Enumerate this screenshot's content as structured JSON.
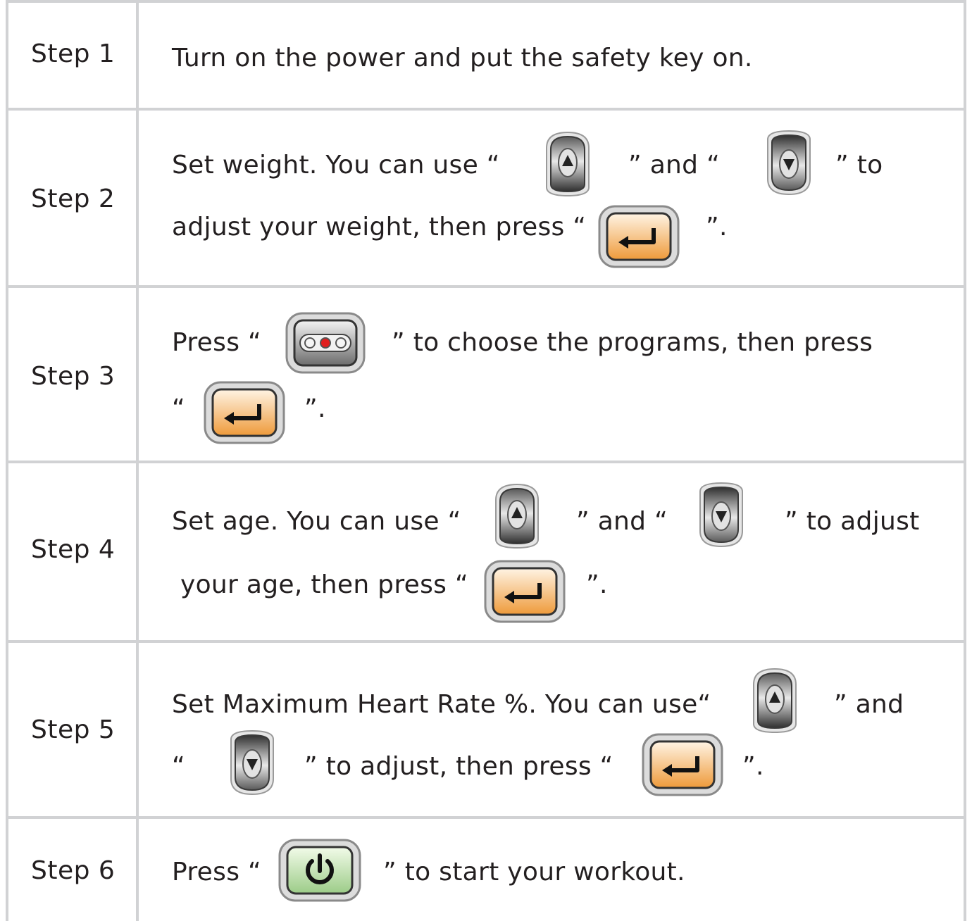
{
  "steps": [
    {
      "label": "Step 1",
      "parts": {
        "a": "Turn on the power and put the safety key on."
      }
    },
    {
      "label": "Step 2",
      "parts": {
        "a": "Set weight. You can use  “",
        "b": "” and “",
        "c": "” to",
        "d": "adjust your weight, then press “",
        "e": "”."
      }
    },
    {
      "label": "Step 3",
      "parts": {
        "a": "Press  “",
        "b": "” to choose the programs, then press",
        "c": "“",
        "d": "”."
      }
    },
    {
      "label": "Step 4",
      "parts": {
        "a": "Set age. You can use “",
        "b": "” and “",
        "c": "” to adjust",
        "d": "your age, then press “",
        "e": "”."
      }
    },
    {
      "label": "Step 5",
      "parts": {
        "a": "Set Maximum Heart Rate %. You can use“",
        "b": "” and",
        "c": "“",
        "d": "”  to adjust, then press “",
        "e": "”."
      }
    },
    {
      "label": "Step 6",
      "parts": {
        "a": "Press “",
        "b": "” to start your workout."
      }
    }
  ],
  "icons": {
    "up": "up-arrow-icon",
    "down": "down-arrow-icon",
    "enter": "enter-icon",
    "program": "program-select-icon",
    "start": "power-start-icon"
  },
  "colors": {
    "grid": "#d1d2d4",
    "text": "#231f20",
    "enter_orange": "#f0a040",
    "start_green": "#9ccc88",
    "program_red": "#e02020"
  }
}
